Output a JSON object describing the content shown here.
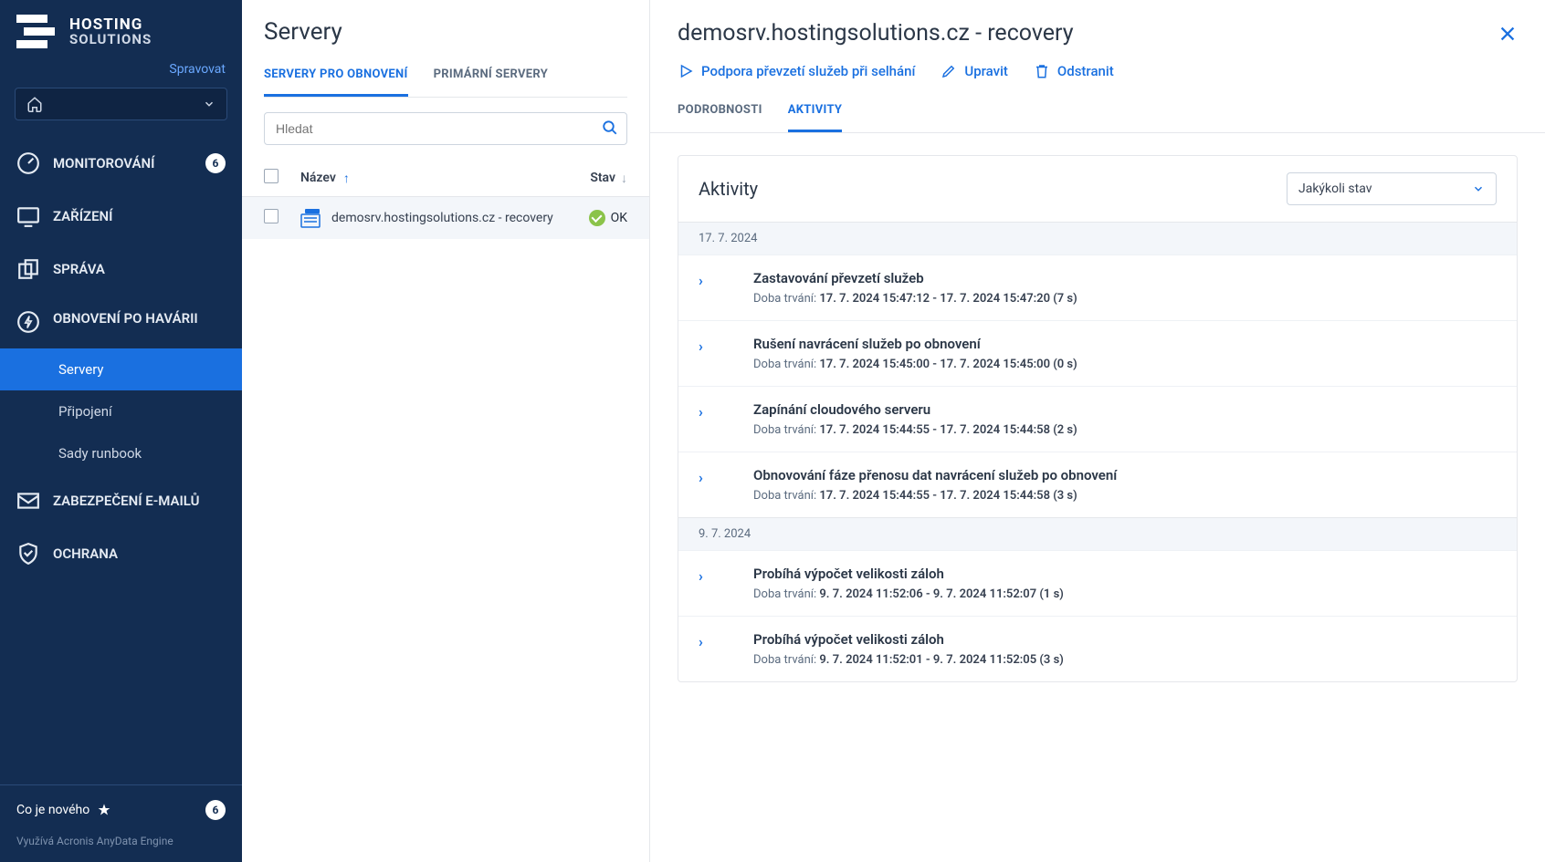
{
  "brand": {
    "line1": "HOSTING",
    "line2": "SOLUTIONS"
  },
  "manage_link": "Spravovat",
  "nav": {
    "monitoring": {
      "label": "MONITOROVÁNÍ",
      "badge": "6"
    },
    "devices": {
      "label": "ZAŘÍZENÍ"
    },
    "admin": {
      "label": "SPRÁVA"
    },
    "dr": {
      "label": "OBNOVENÍ PO HAVÁRII"
    },
    "dr_sub": {
      "servers": "Servery",
      "connection": "Připojení",
      "runbooks": "Sady runbook"
    },
    "email_sec": {
      "label": "ZABEZPEČENÍ E-MAILŮ"
    },
    "protection": {
      "label": "OCHRANA"
    }
  },
  "whatsnew": {
    "label": "Co je nového",
    "badge": "6"
  },
  "powered": "Využívá Acronis AnyData Engine",
  "center": {
    "title": "Servery",
    "tabs": {
      "recovery": "SERVERY PRO OBNOVENÍ",
      "primary": "PRIMÁRNÍ SERVERY"
    },
    "search_placeholder": "Hledat",
    "cols": {
      "name": "Název",
      "state": "Stav"
    },
    "row": {
      "name": "demosrv.hostingsolutions.cz - recovery",
      "state": "OK"
    }
  },
  "detail": {
    "title": "demosrv.hostingsolutions.cz - recovery",
    "actions": {
      "failover": "Podpora převzetí služeb při selhání",
      "edit": "Upravit",
      "delete": "Odstranit"
    },
    "tabs": {
      "details": "PODROBNOSTI",
      "activities": "AKTIVITY"
    },
    "card_title": "Aktivity",
    "state_filter": "Jakýkoli stav",
    "duration_label": "Doba trvání:",
    "groups": [
      {
        "date": "17. 7. 2024",
        "items": [
          {
            "title": "Zastavování převzetí služeb",
            "dur": "17. 7. 2024 15:47:12 - 17. 7. 2024 15:47:20 (7 s)"
          },
          {
            "title": "Rušení navrácení služeb po obnovení",
            "dur": "17. 7. 2024 15:45:00 - 17. 7. 2024 15:45:00 (0 s)"
          },
          {
            "title": "Zapínání cloudového serveru",
            "dur": "17. 7. 2024 15:44:55 - 17. 7. 2024 15:44:58 (2 s)"
          },
          {
            "title": "Obnovování fáze přenosu dat navrácení služeb po obnovení",
            "dur": "17. 7. 2024 15:44:55 - 17. 7. 2024 15:44:58 (3 s)"
          }
        ]
      },
      {
        "date": "9. 7. 2024",
        "items": [
          {
            "title": "Probíhá výpočet velikosti záloh",
            "dur": "9. 7. 2024 11:52:06 - 9. 7. 2024 11:52:07 (1 s)"
          },
          {
            "title": "Probíhá výpočet velikosti záloh",
            "dur": "9. 7. 2024 11:52:01 - 9. 7. 2024 11:52:05 (3 s)"
          }
        ]
      }
    ]
  }
}
